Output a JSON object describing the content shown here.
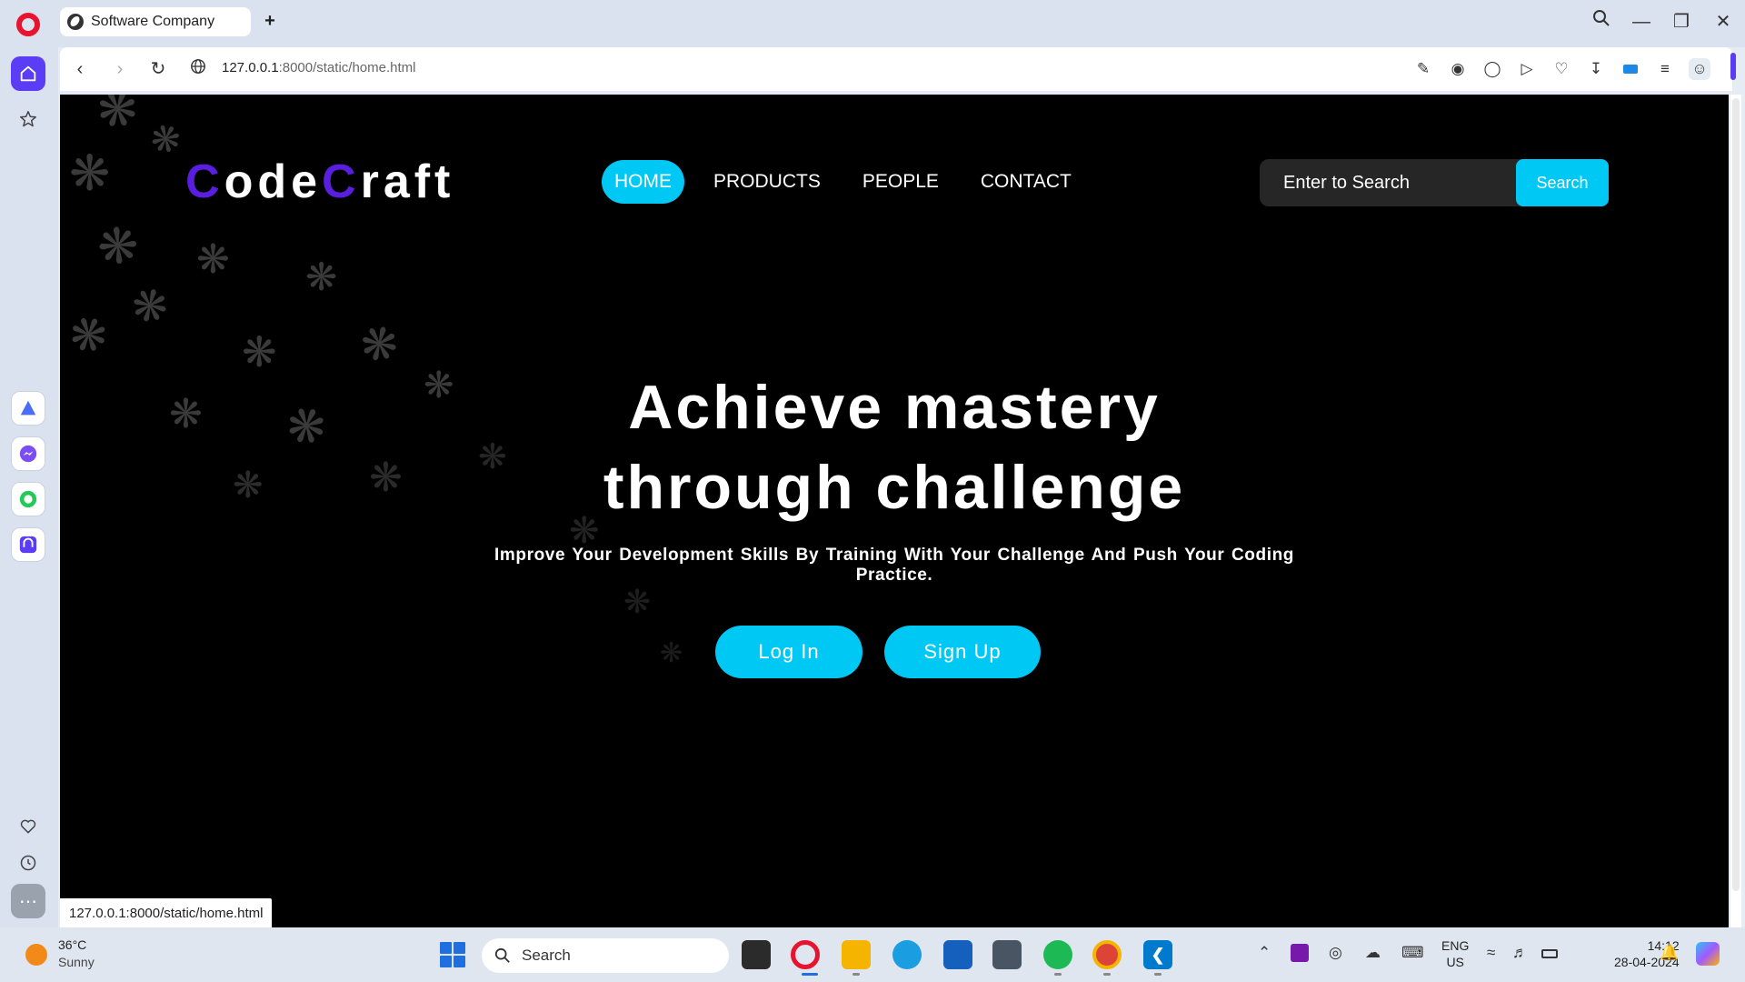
{
  "browser": {
    "tab_title": "Software Company",
    "url_host": "127.0.0.1",
    "url_path": ":8000/static/home.html",
    "status_url": "127.0.0.1:8000/static/home.html"
  },
  "site": {
    "logo_c1": "C",
    "logo_part1": "ode",
    "logo_c2": "C",
    "logo_part2": "raft",
    "nav": [
      {
        "label": "HOME",
        "active": true
      },
      {
        "label": "PRODUCTS",
        "active": false
      },
      {
        "label": "PEOPLE",
        "active": false
      },
      {
        "label": "CONTACT",
        "active": false
      }
    ],
    "search_placeholder": "Enter to Search",
    "search_button": "Search",
    "hero_line1": "Achieve mastery",
    "hero_line2": "through challenge",
    "hero_subtitle": "Improve Your Development Skills By Training With Your Challenge And Push Your Coding Practice.",
    "login_label": "Log In",
    "signup_label": "Sign Up",
    "accent_color": "#00c8f5",
    "logo_accent_color": "#5a1ee0"
  },
  "taskbar": {
    "temperature": "36°C",
    "condition": "Sunny",
    "search_label": "Search",
    "lang_line1": "ENG",
    "lang_line2": "US",
    "time": "14:12",
    "date": "28-04-2024"
  }
}
